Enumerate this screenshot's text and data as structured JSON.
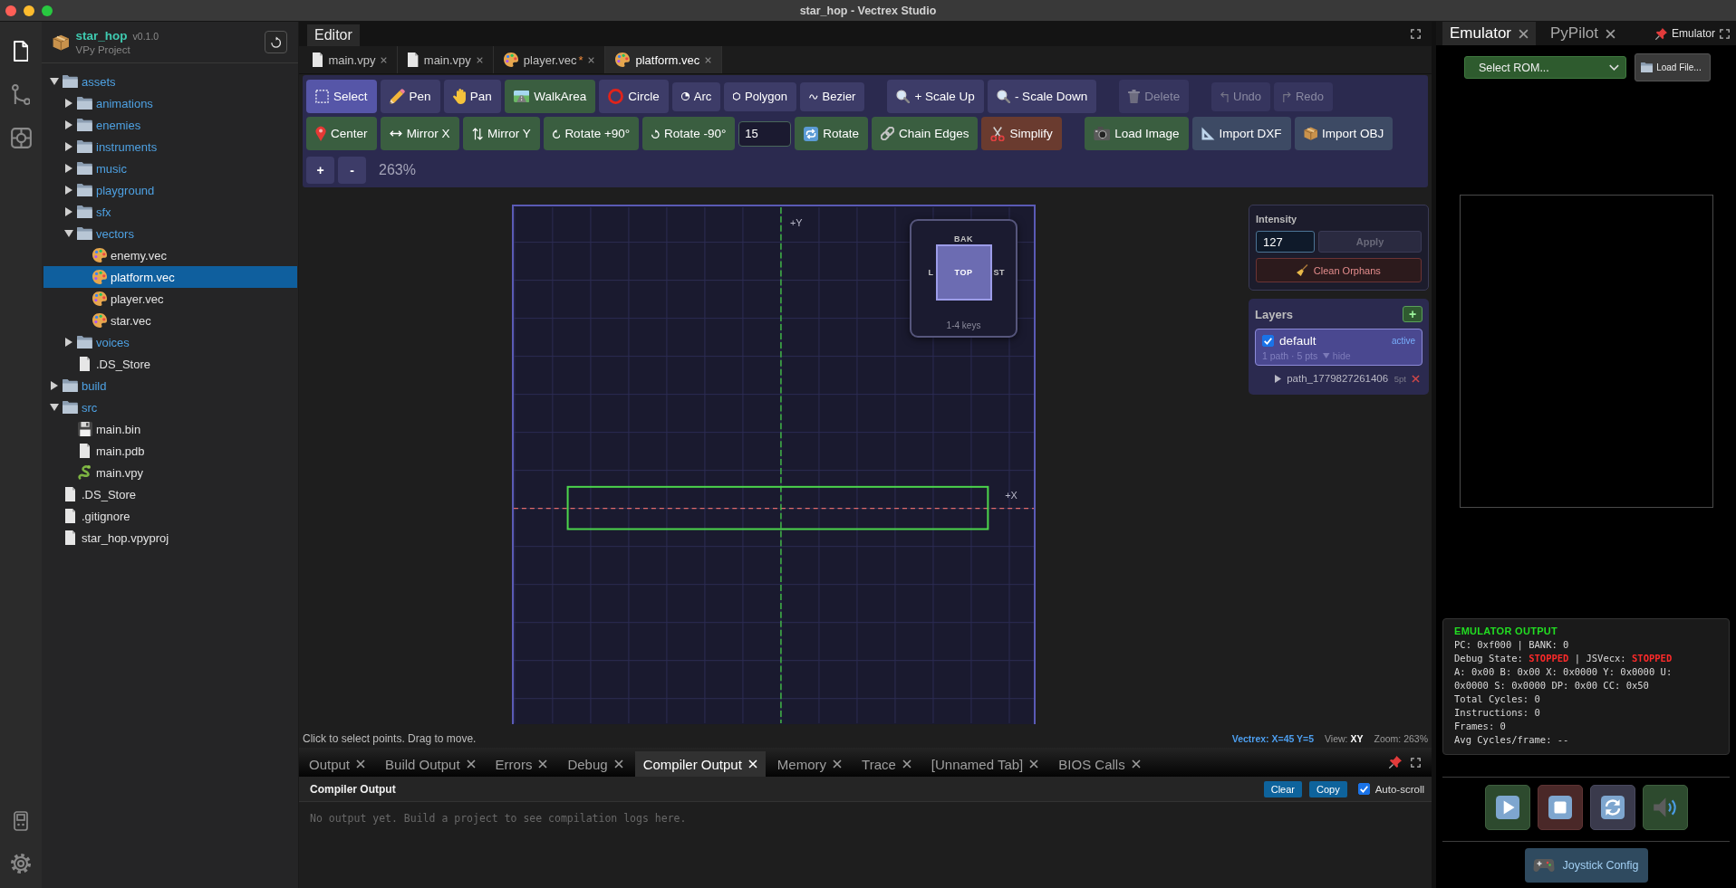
{
  "window": {
    "title": "star_hop - Vectrex Studio"
  },
  "activity_bar": {
    "items": [
      {
        "kind": "files",
        "selected": true
      },
      {
        "kind": "source_control",
        "selected": false
      },
      {
        "kind": "modules",
        "selected": false
      }
    ]
  },
  "sidebar": {
    "project": {
      "name": "star_hop",
      "version": "v0.1.0",
      "type": "VPy Project"
    },
    "tree": [
      {
        "label": "assets",
        "kind": "folder",
        "expanded": true,
        "selected": false,
        "children": [
          {
            "label": "animations",
            "kind": "folder",
            "expanded": false,
            "selected": false
          },
          {
            "label": "enemies",
            "kind": "folder",
            "expanded": false,
            "selected": false
          },
          {
            "label": "instruments",
            "kind": "folder",
            "expanded": false,
            "selected": false
          },
          {
            "label": "music",
            "kind": "folder",
            "expanded": false,
            "selected": false
          },
          {
            "label": "playground",
            "kind": "folder",
            "expanded": false,
            "selected": false
          },
          {
            "label": "sfx",
            "kind": "folder",
            "expanded": false,
            "selected": false
          },
          {
            "label": "vectors",
            "kind": "folder",
            "expanded": true,
            "selected": false,
            "children": [
              {
                "label": "enemy.vec",
                "kind": "vector",
                "selected": false
              },
              {
                "label": "platform.vec",
                "kind": "vector",
                "selected": true
              },
              {
                "label": "player.vec",
                "kind": "vector",
                "selected": false
              },
              {
                "label": "star.vec",
                "kind": "vector",
                "selected": false
              }
            ]
          },
          {
            "label": "voices",
            "kind": "folder",
            "expanded": false,
            "selected": false
          },
          {
            "label": ".DS_Store",
            "kind": "file",
            "selected": false
          }
        ]
      },
      {
        "label": "build",
        "kind": "folder",
        "expanded": false,
        "selected": false
      },
      {
        "label": "src",
        "kind": "folder",
        "expanded": true,
        "selected": false,
        "children": [
          {
            "label": "main.bin",
            "kind": "binary",
            "selected": false
          },
          {
            "label": "main.pdb",
            "kind": "file",
            "selected": false
          },
          {
            "label": "main.vpy",
            "kind": "python",
            "selected": false
          }
        ]
      },
      {
        "label": ".DS_Store",
        "kind": "file",
        "selected": false
      },
      {
        "label": ".gitignore",
        "kind": "file",
        "selected": false
      },
      {
        "label": "star_hop.vpyproj",
        "kind": "file",
        "selected": false
      }
    ]
  },
  "editor": {
    "title": "Editor",
    "tabs": [
      {
        "label": "main.vpy",
        "kind": "file",
        "selected": false
      },
      {
        "label": "main.vpy",
        "kind": "file",
        "selected": false
      },
      {
        "label": "player.vec",
        "kind": "vector",
        "modified_mark": "*",
        "selected": false
      },
      {
        "label": "platform.vec",
        "kind": "vector",
        "selected": true
      }
    ],
    "toolbar": {
      "tools": [
        {
          "label": "Select",
          "kind": "select",
          "selected": true
        },
        {
          "label": "Pen",
          "kind": "pen",
          "selected": false
        },
        {
          "label": "Pan",
          "kind": "pan",
          "selected": false
        },
        {
          "label": "WalkArea",
          "kind": "walkarea",
          "selected": false
        },
        {
          "label": "Circle",
          "kind": "circle",
          "selected": false
        },
        {
          "label": "Arc",
          "kind": "arc",
          "selected": false
        },
        {
          "label": "Polygon",
          "kind": "polygon",
          "selected": false
        },
        {
          "label": "Bezier",
          "kind": "bezier",
          "selected": false
        }
      ],
      "scale": [
        {
          "label": "+ Scale Up",
          "kind": "magnifier"
        },
        {
          "label": "- Scale Down",
          "kind": "magnifier"
        }
      ],
      "delete": {
        "label": "Delete",
        "kind": "trash",
        "disabled": true
      },
      "history": [
        {
          "label": "Undo",
          "kind": "undo",
          "disabled": true
        },
        {
          "label": "Redo",
          "kind": "redo",
          "disabled": true
        }
      ],
      "transforms": [
        {
          "label": "Center",
          "kind": "pin"
        },
        {
          "label": "Mirror X",
          "kind": "mirror_x"
        },
        {
          "label": "Mirror Y",
          "kind": "mirror_y"
        },
        {
          "label": "Rotate +90°",
          "kind": "rotate_ccw"
        },
        {
          "label": "Rotate -90°",
          "kind": "rotate_cw"
        }
      ],
      "angle": "15",
      "shape_actions": [
        {
          "label": "Rotate",
          "kind": "repeat"
        },
        {
          "label": "Chain Edges",
          "kind": "link"
        },
        {
          "label": "Simplify",
          "kind": "scissors"
        }
      ],
      "imports": [
        {
          "label": "Load Image",
          "kind": "camera"
        },
        {
          "label": "Import DXF",
          "kind": "ruler"
        },
        {
          "label": "Import OBJ",
          "kind": "package"
        }
      ],
      "zoom_in": "+",
      "zoom_out": "-",
      "zoom_level": "263%"
    },
    "canvas": {
      "axis_labels": {
        "y": "+Y",
        "x": "+X"
      },
      "view_cube": {
        "top": "BAK",
        "left": "L",
        "face": "TOP",
        "right": "ST",
        "hint": "1-4 keys"
      }
    },
    "intensity": {
      "label": "Intensity",
      "value": "127",
      "apply": {
        "label": "Apply",
        "disabled": true
      },
      "clean": "Clean Orphans"
    },
    "layers": {
      "title": "Layers",
      "add": "+",
      "items": [
        {
          "name": "default",
          "visible": true,
          "selected": true,
          "status": "active",
          "summary": "1 path · 5 pts",
          "toggle": "hide",
          "paths": [
            {
              "name": "path_1779827261406",
              "points": "5pt"
            }
          ]
        }
      ]
    },
    "status_bar": {
      "hint": "Click to select points. Drag to move.",
      "coords": "Vectrex: X=45 Y=5",
      "view": "View: **XY**",
      "zoom": "Zoom: 263%"
    }
  },
  "bottom_panel": {
    "tabs": [
      {
        "label": "Output",
        "selected": false
      },
      {
        "label": "Build Output",
        "selected": false
      },
      {
        "label": "Errors",
        "selected": false
      },
      {
        "label": "Debug",
        "selected": false
      },
      {
        "label": "Compiler Output",
        "selected": true
      },
      {
        "label": "Memory",
        "selected": false
      },
      {
        "label": "Trace",
        "selected": false
      },
      {
        "label": "[Unnamed Tab]",
        "selected": false
      },
      {
        "label": "BIOS Calls",
        "selected": false
      }
    ],
    "title": "Compiler Output",
    "actions": [
      "Clear",
      "Copy"
    ],
    "auto_scroll": {
      "label": "Auto-scroll",
      "checked": true
    },
    "message": "No output yet. Build a project to see compilation logs here."
  },
  "emulator": {
    "tabs": [
      {
        "label": "Emulator",
        "selected": true
      },
      {
        "label": "PyPilot",
        "selected": false
      }
    ],
    "pinned_label": "Emulator",
    "rom_select": "Select ROM...",
    "load_button": "Load File...",
    "output": {
      "title": "EMULATOR OUTPUT",
      "lines": [
        "PC: 0xf000 | BANK: 0",
        "Debug State: **STOPPED** | JSVecx: **STOPPED**",
        "A: 0x00 B: 0x00 X: 0x0000 Y: 0x0000 U: 0x0000 S: 0x0000 DP: 0x00 CC: 0x50",
        "Total Cycles: 0",
        "Instructions: 0",
        "Frames: 0",
        "Avg Cycles/frame: --"
      ]
    },
    "joystick_button": "Joystick Config"
  }
}
